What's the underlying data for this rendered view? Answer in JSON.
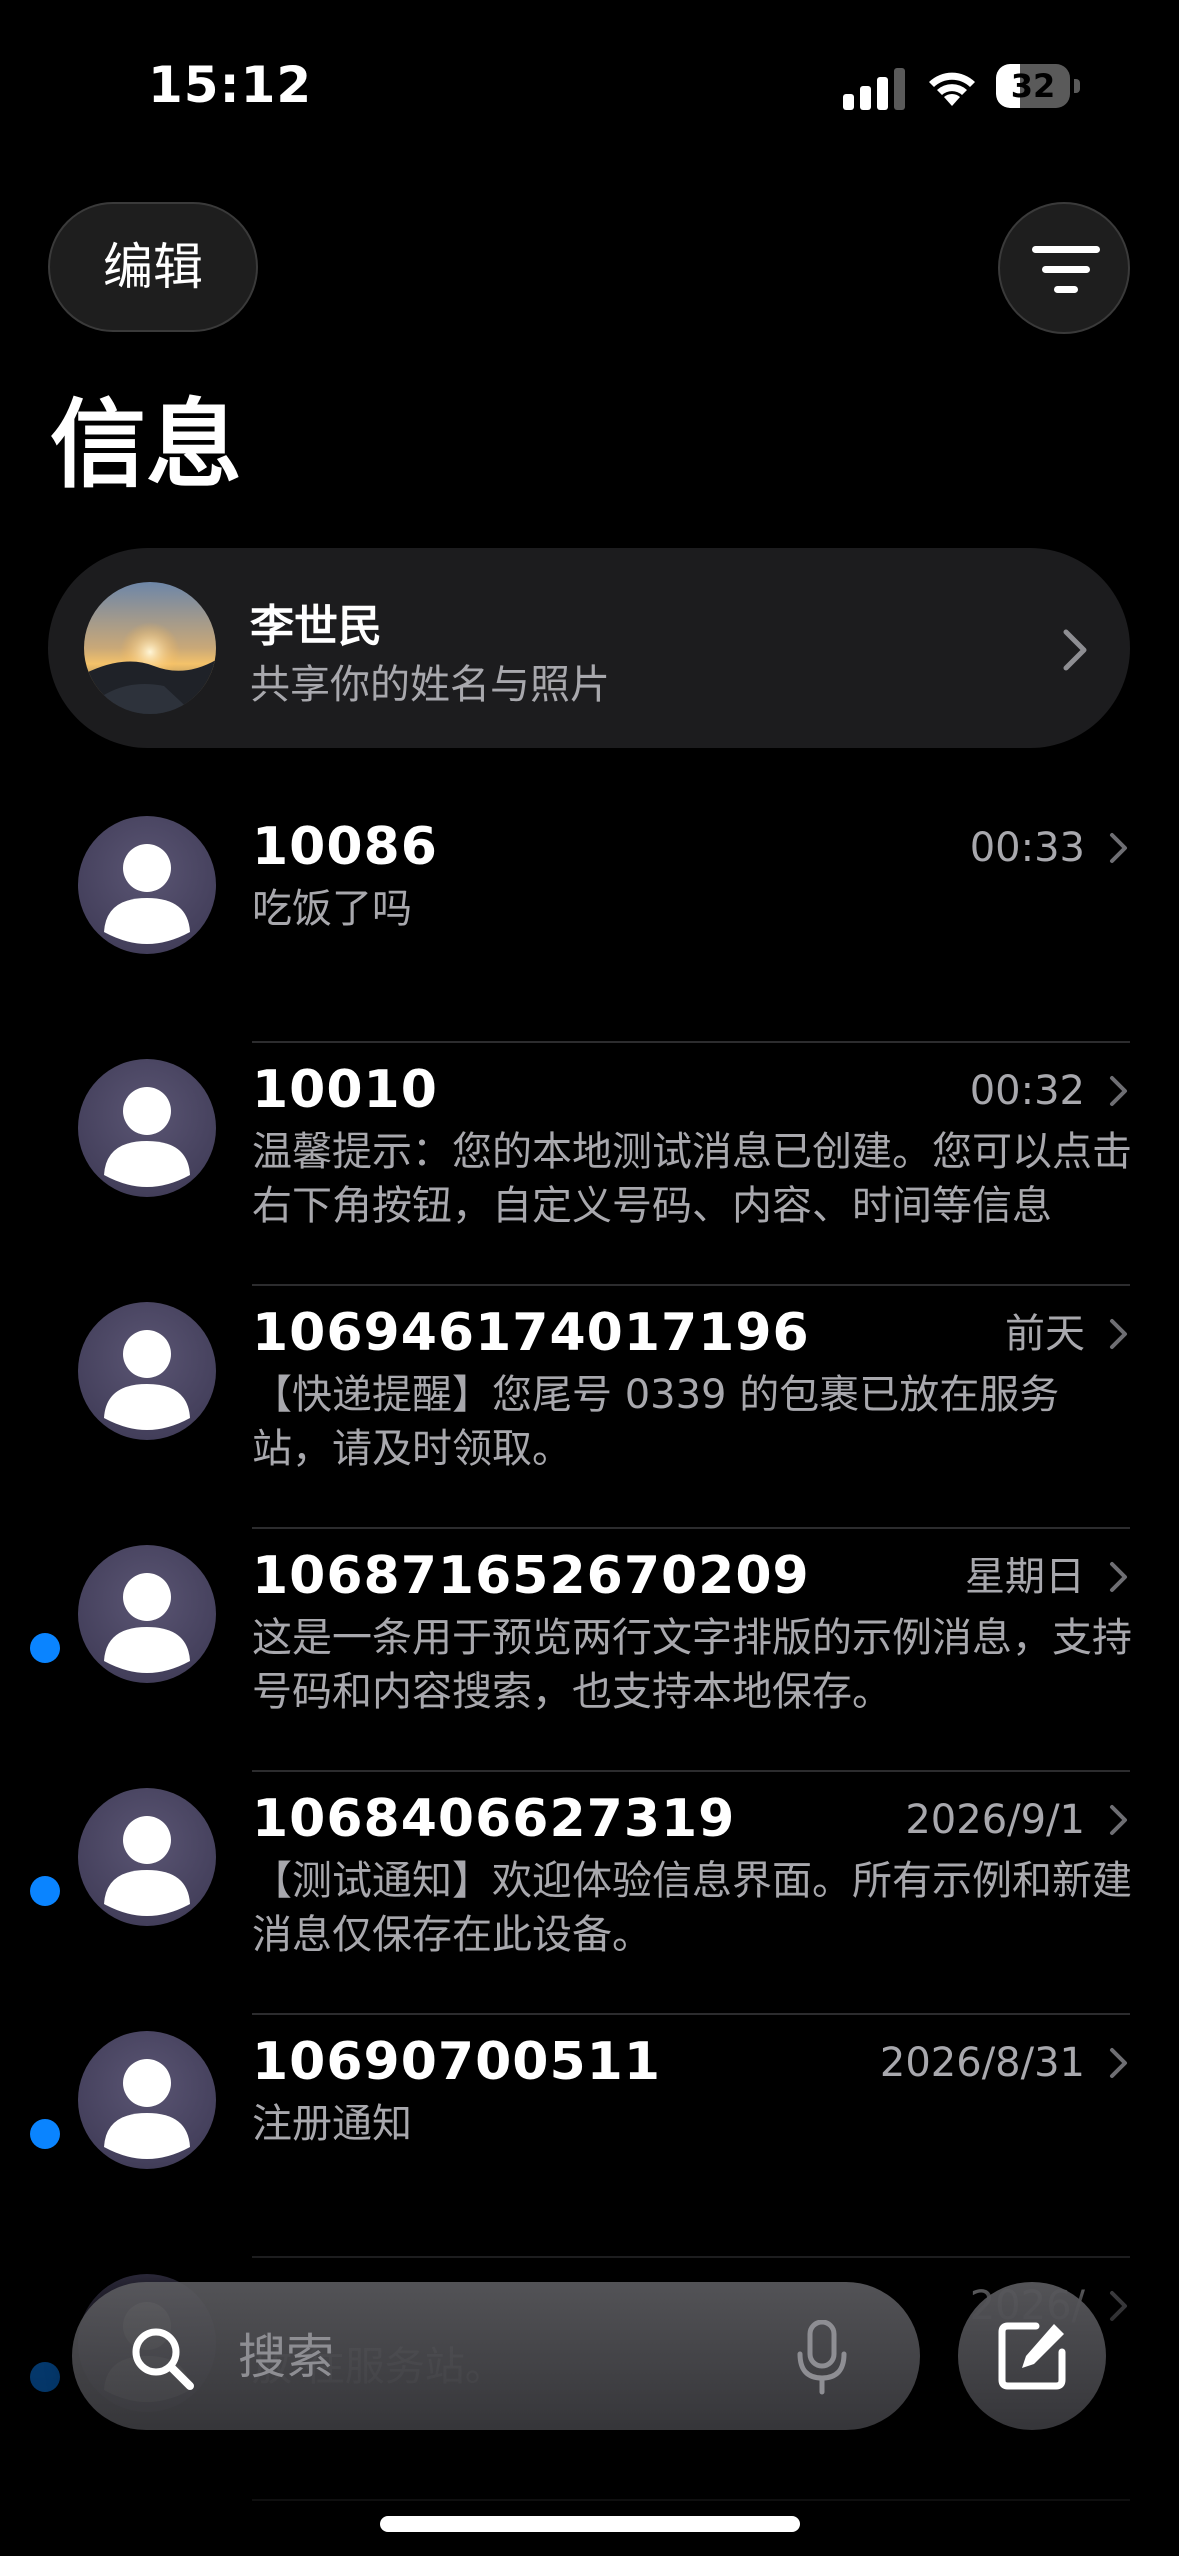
{
  "status_bar": {
    "time": "15:12",
    "battery": "32",
    "battery_level": 0.32
  },
  "header": {
    "edit_label": "编辑",
    "title": "信息"
  },
  "profile": {
    "name": "李世民",
    "subtitle": "共享你的姓名与照片"
  },
  "messages": [
    {
      "sender": "10086",
      "time": "00:33",
      "preview": "吃饭了吗",
      "unread": false
    },
    {
      "sender": "10010",
      "time": "00:32",
      "preview": "温馨提示：您的本地测试消息已创建。您可以点击右下角按钮，自定义号码、内容、时间等信息",
      "unread": false
    },
    {
      "sender": "106946174017196",
      "time": "前天",
      "preview": "【快递提醒】您尾号 0339 的包裹已放在服务站，请及时领取。",
      "unread": false
    },
    {
      "sender": "106871652670209",
      "time": "星期日",
      "preview": "这是一条用于预览两行文字排版的示例消息，支持号码和内容搜索，也支持本地保存。",
      "unread": true
    },
    {
      "sender": "1068406627319",
      "time": "2026/9/1",
      "preview": "【测试通知】欢迎体验信息界面。所有示例和新建消息仅保存在此设备。",
      "unread": true
    },
    {
      "sender": "10690700511",
      "time": "2026/8/31",
      "preview": "注册通知",
      "unread": true
    },
    {
      "sender": "",
      "time": "2026/",
      "preview": "放\n往服务站。",
      "unread": true
    }
  ],
  "search": {
    "placeholder": "搜索"
  },
  "icons": {
    "filter": "filter-icon",
    "chevron": "chevron-right-icon",
    "search": "search-icon",
    "mic": "mic-icon",
    "compose": "compose-icon",
    "avatar": "person-avatar-icon"
  },
  "colors": {
    "unread_dot": "#0a84ff",
    "background": "#000000",
    "secondary_text": "#a8a8ad"
  }
}
